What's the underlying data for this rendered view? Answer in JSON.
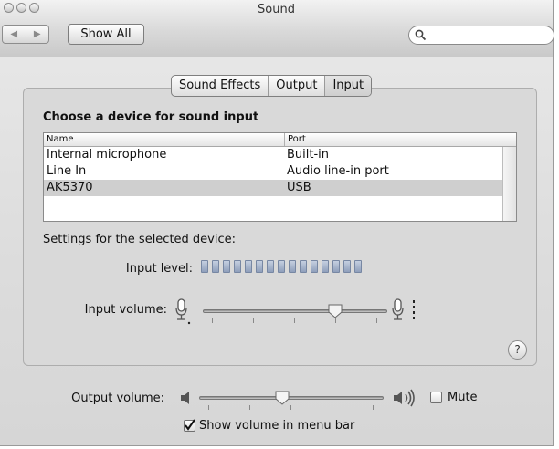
{
  "window": {
    "title": "Sound"
  },
  "toolbar": {
    "show_all_label": "Show All",
    "search_placeholder": ""
  },
  "tabs": [
    {
      "label": "Sound Effects",
      "selected": false
    },
    {
      "label": "Output",
      "selected": false
    },
    {
      "label": "Input",
      "selected": true
    }
  ],
  "input": {
    "heading": "Choose a device for sound input",
    "columns": [
      "Name",
      "Port"
    ],
    "devices": [
      {
        "name": "Internal microphone",
        "port": "Built-in"
      },
      {
        "name": "Line In",
        "port": "Audio line-in port"
      },
      {
        "name": "AK5370",
        "port": "USB",
        "selected": true
      }
    ],
    "settings_label": "Settings for the selected device:",
    "input_level_label": "Input level:",
    "input_level_segments": 15,
    "input_volume_label": "Input volume:",
    "input_volume_value": 0.72
  },
  "output": {
    "output_volume_label": "Output volume:",
    "output_volume_value": 0.45,
    "mute_label": "Mute",
    "mute_checked": false,
    "show_volume_label": "Show volume in menu bar",
    "show_volume_checked": true
  },
  "help_label": "?",
  "colors": {
    "pointer_arrow": "#1a73c9",
    "selected_row": "#cfcfcf",
    "level_meter": "#8f9fbb"
  }
}
